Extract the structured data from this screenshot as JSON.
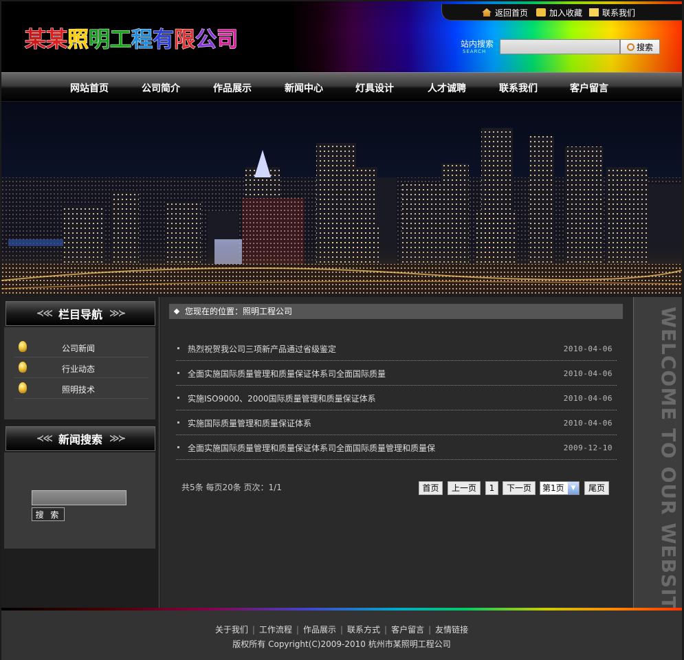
{
  "header": {
    "logo_text": "某某照明工程有限公司",
    "logo_colors": [
      "#d01818",
      "#e02020",
      "#ffcc00",
      "#19a020",
      "#18a818",
      "#1e8ee0",
      "#2d40d8",
      "#e03030",
      "#8838d8",
      "#e020a0"
    ],
    "top_links": [
      {
        "label": "返回首页",
        "icon": "home-icon"
      },
      {
        "label": "加入收藏",
        "icon": "favorite-icon"
      },
      {
        "label": "联系我们",
        "icon": "mail-icon"
      }
    ],
    "search": {
      "label": "站内搜索",
      "sub_label": "SEARCH",
      "input_value": "",
      "button_label": "搜索"
    }
  },
  "nav": {
    "items": [
      "网站首页",
      "公司简介",
      "作品展示",
      "新闻中心",
      "灯具设计",
      "人才诚聘",
      "联系我们",
      "客户留言"
    ]
  },
  "sidebar": {
    "section_title": "栏目导航",
    "categories": [
      "公司新闻",
      "行业动态",
      "照明技术"
    ],
    "search_title": "新闻搜索",
    "search_input_value": "",
    "search_button_label": "搜 索"
  },
  "main": {
    "breadcrumb": "您现在的位置：照明工程公司",
    "news": [
      {
        "title": "热烈祝贺我公司三项新产品通过省级鉴定",
        "date": "2010-04-06"
      },
      {
        "title": "全面实施国际质量管理和质量保证体系司全面国际质量",
        "date": "2010-04-06"
      },
      {
        "title": "实施ISO9000、2000国际质量管理和质量保证体系",
        "date": "2010-04-06"
      },
      {
        "title": "实施国际质量管理和质量保证体系",
        "date": "2010-04-06"
      },
      {
        "title": "全面实施国际质量管理和质量保证体系司全面国际质量管理和质量保",
        "date": "2009-12-10"
      }
    ],
    "pager": {
      "info": "共5条  每页20条  页次：1/1",
      "first": "首页",
      "prev": "上一页",
      "current": "1",
      "next": "下一页",
      "select_value": "第1页",
      "last": "尾页"
    }
  },
  "welcome_text": "WELCOME TO OUR WEBSITE",
  "footer": {
    "links": [
      "关于我们",
      "工作流程",
      "作品展示",
      "联系方式",
      "客户留言",
      "友情链接"
    ],
    "copyright": "版权所有  Copyright(C)2009-2010 杭州市某照明工程公司"
  }
}
